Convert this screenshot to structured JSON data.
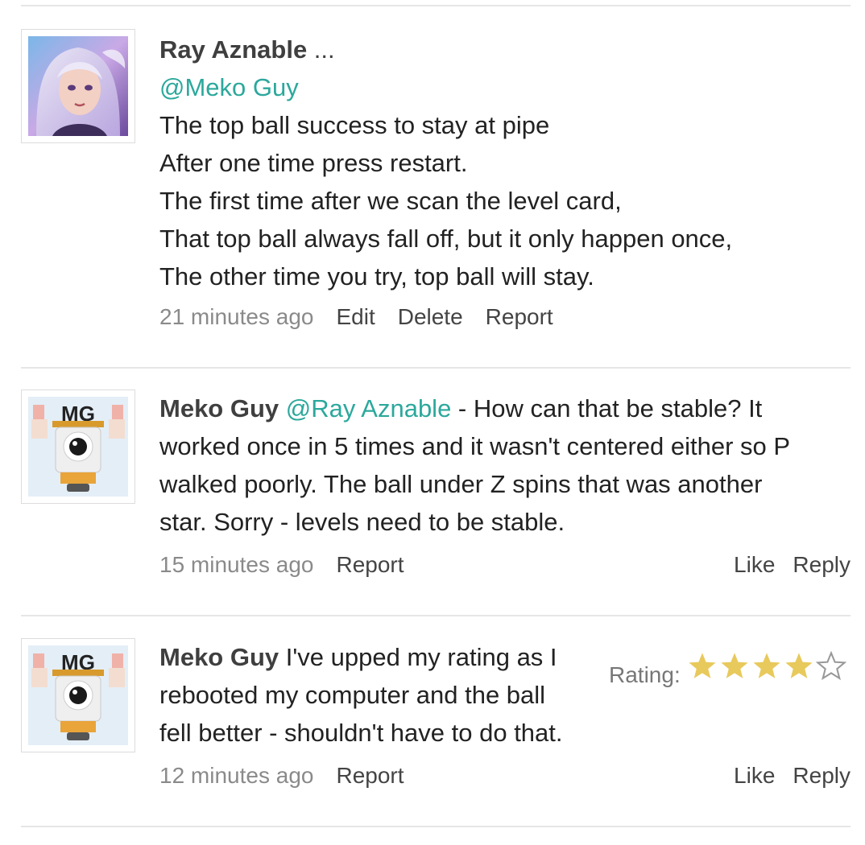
{
  "comments": [
    {
      "author": "Ray Aznable",
      "author_suffix": " ...",
      "lines": [
        "@Meko Guy",
        "The top ball success to stay at pipe",
        "After one time press restart.",
        "The first time after we scan the level card,",
        "That top ball always fall off, but it only happen once,",
        "The other time you try, top ball will stay."
      ],
      "time": "21 minutes ago",
      "actions": [
        "Edit",
        "Delete",
        "Report"
      ]
    },
    {
      "author": "Meko Guy",
      "mention": "@Ray Aznable",
      "lines": [
        " - How can that be stable? It",
        "worked once in 5 times and it wasn't centered either so P",
        "walked poorly. The ball under Z spins that was another",
        "star. Sorry - levels need to be stable."
      ],
      "time": "15 minutes ago",
      "actions": [
        "Report"
      ],
      "right_actions": [
        "Like",
        "Reply"
      ]
    },
    {
      "author": "Meko Guy",
      "lines": [
        " I've upped my rating as I",
        "rebooted my computer and the ball",
        "fell better - shouldn't have to do that."
      ],
      "time": "12 minutes ago",
      "actions": [
        "Report"
      ],
      "right_actions": [
        "Like",
        "Reply"
      ],
      "rating_label": "Rating:",
      "rating": 4,
      "rating_max": 5
    }
  ],
  "colors": {
    "mention": "#2ca89c",
    "star_filled": "#e8c95c",
    "star_empty": "#999999"
  }
}
